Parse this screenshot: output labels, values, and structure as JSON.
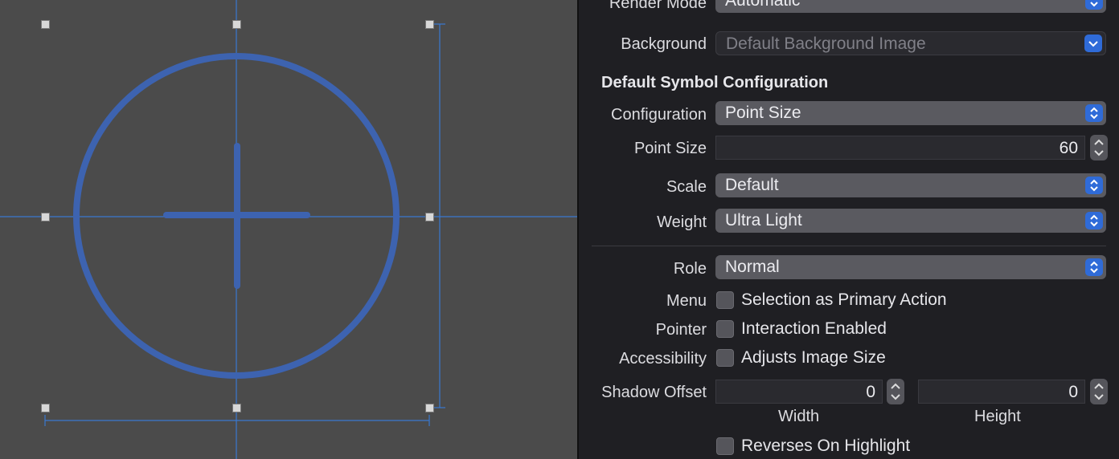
{
  "inspector": {
    "render_mode": {
      "label": "Render Mode",
      "value": "Automatic"
    },
    "background": {
      "label": "Background",
      "placeholder": "Default Background Image"
    },
    "section_title": "Default Symbol Configuration",
    "configuration": {
      "label": "Configuration",
      "value": "Point Size"
    },
    "point_size": {
      "label": "Point Size",
      "value": "60"
    },
    "scale": {
      "label": "Scale",
      "value": "Default"
    },
    "weight": {
      "label": "Weight",
      "value": "Ultra Light"
    },
    "role": {
      "label": "Role",
      "value": "Normal"
    },
    "menu": {
      "label": "Menu",
      "checkbox_label": "Selection as Primary Action",
      "checked": false
    },
    "pointer": {
      "label": "Pointer",
      "checkbox_label": "Interaction Enabled",
      "checked": false
    },
    "accessibility": {
      "label": "Accessibility",
      "checkbox_label": "Adjusts Image Size",
      "checked": false
    },
    "shadow_offset": {
      "label": "Shadow Offset",
      "width_value": "0",
      "width_label": "Width",
      "height_value": "0",
      "height_label": "Height"
    },
    "reverses": {
      "checkbox_label": "Reverses On Highlight",
      "checked": false
    }
  },
  "canvas": {
    "symbol_icon": "plus-circle-icon",
    "symbol_color": "#3d63b0",
    "guide_color": "#3a78d0"
  }
}
